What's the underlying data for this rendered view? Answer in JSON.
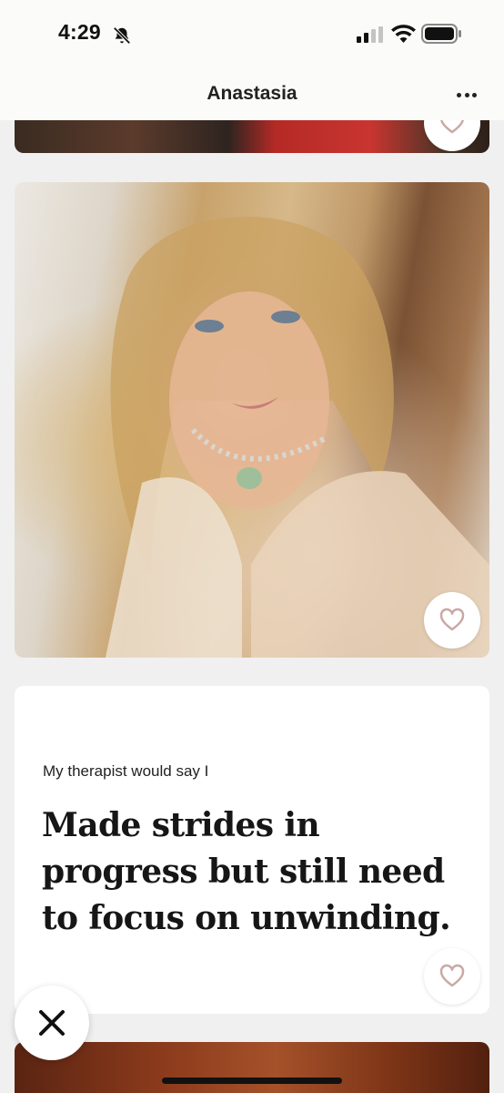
{
  "status_bar": {
    "time": "4:29",
    "icons": [
      "bell-slash-icon",
      "cellular-signal-icon",
      "wifi-icon",
      "battery-icon"
    ]
  },
  "header": {
    "title": "Anastasia",
    "more_icon": "ellipsis-icon"
  },
  "photos": [
    {
      "name": "profile-photo-previous",
      "like_icon": "heart-outline-icon"
    },
    {
      "name": "profile-photo-selfie",
      "like_icon": "heart-outline-icon"
    },
    {
      "name": "profile-photo-next"
    }
  ],
  "prompt": {
    "question": "My therapist would say I",
    "answer": "Made strides in progress but still need to focus on unwinding.",
    "like_icon": "heart-outline-icon"
  },
  "actions": {
    "skip_icon": "close-x-icon"
  },
  "colors": {
    "background": "#f0f0f0",
    "card": "#ffffff",
    "heart": "#c9a9a4",
    "text": "#161616"
  }
}
